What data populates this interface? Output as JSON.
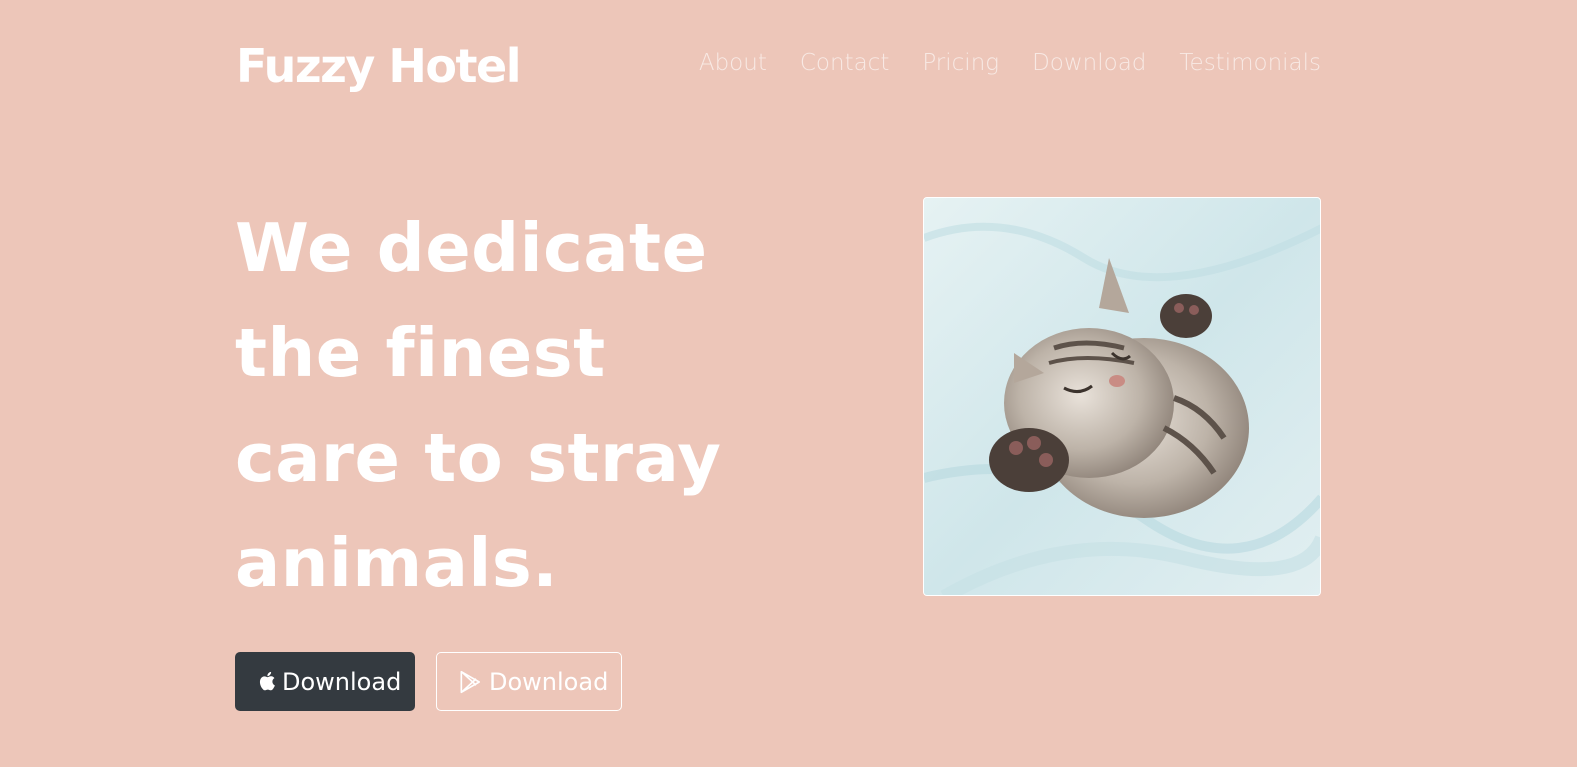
{
  "brand": {
    "title": "Fuzzy Hotel"
  },
  "nav": {
    "items": [
      "About",
      "Contact",
      "Pricing",
      "Download",
      "Testimonials"
    ]
  },
  "hero": {
    "lines": [
      "We dedicate",
      "the finest",
      "care to stray",
      "animals."
    ]
  },
  "buttons": {
    "apple": {
      "label": "Download",
      "icon": "apple-icon"
    },
    "google": {
      "label": "Download",
      "icon": "google-play-icon"
    }
  },
  "colors": {
    "background": "#edc6b9",
    "text": "#ffffff",
    "dark_button": "#343a40"
  }
}
